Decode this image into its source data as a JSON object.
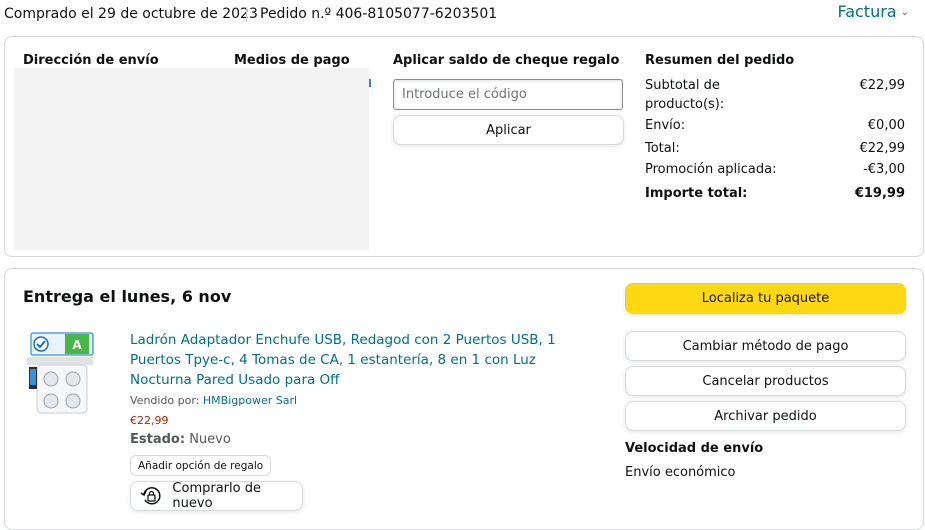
{
  "header": {
    "purchased": "Comprado el 29 de octubre de 2023",
    "order_number": "Pedido n.º 406-8105077-6203501",
    "invoice": "Factura"
  },
  "order_info": {
    "shipping_address_title": "Dirección de envío",
    "payment_methods_title": "Medios de pago",
    "gift_card": {
      "title": "Aplicar saldo de cheque regalo",
      "placeholder": "Introduce el código",
      "apply": "Aplicar"
    },
    "summary": {
      "title": "Resumen del pedido",
      "rows": [
        {
          "label": "Subtotal de producto(s):",
          "value": "€22,99"
        },
        {
          "label": "Envío:",
          "value": "€0,00"
        },
        {
          "label": "Total:",
          "value": "€22,99"
        },
        {
          "label": "Promoción aplicada:",
          "value": "-€3,00"
        },
        {
          "label": "Importe total:",
          "value": "€19,99"
        }
      ]
    }
  },
  "shipment": {
    "delivery_title": "Entrega el lunes, 6 nov",
    "track_package": "Localiza tu paquete",
    "product": {
      "title": "Ladrón Adaptador Enchufe USB, Redagod con 2 Puertos USB, 1 Puertos Tpye-c, 4 Tomas de CA, 1 estantería, 8 en 1 con Luz Nocturna Pared Usado para Off",
      "sold_by_label": "Vendido por:",
      "seller": "HMBigpower Sarl",
      "price": "€22,99",
      "state_label": "Estado:",
      "state_value": "Nuevo",
      "gift_option": "Añadir opción de regalo",
      "buy_again": "Comprarlo de nuevo",
      "badge_letter": "A"
    },
    "actions": {
      "change_payment": "Cambiar método de pago",
      "cancel_products": "Cancelar productos",
      "archive_order": "Archivar pedido"
    },
    "shipping_speed": {
      "title": "Velocidad de envío",
      "value": "Envío económico"
    }
  },
  "colors": {
    "link": "#007185",
    "price": "#b12704",
    "primary_button": "#ffd814",
    "border": "#d5d9d9"
  }
}
